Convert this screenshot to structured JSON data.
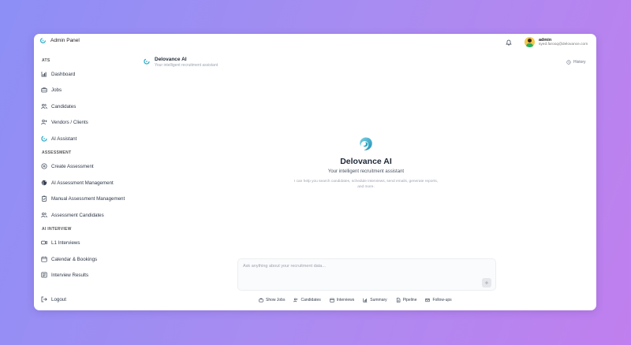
{
  "app": {
    "title": "Admin Panel"
  },
  "user": {
    "name": "admin",
    "email": "syed.farooq@delovance.com"
  },
  "sidebar": {
    "sections": [
      {
        "label": "ATS"
      },
      {
        "label": "ASSESSMENT"
      },
      {
        "label": "AI INTERVIEW"
      }
    ],
    "items": [
      {
        "label": "Dashboard",
        "icon": "chart-icon"
      },
      {
        "label": "Jobs",
        "icon": "briefcase-icon"
      },
      {
        "label": "Candidates",
        "icon": "users-icon"
      },
      {
        "label": "Vendors / Clients",
        "icon": "user-plus-icon"
      },
      {
        "label": "AI Assistant",
        "icon": "ai-logo-icon"
      },
      {
        "label": "Create Assessment",
        "icon": "plus-circle-icon"
      },
      {
        "label": "AI Assessment Management",
        "icon": "globe-icon"
      },
      {
        "label": "Manual Assessment Management",
        "icon": "clipboard-icon"
      },
      {
        "label": "Assessment Candidates",
        "icon": "users-icon"
      },
      {
        "label": "L1 Interviews",
        "icon": "video-icon"
      },
      {
        "label": "Calendar & Bookings",
        "icon": "calendar-icon"
      },
      {
        "label": "Interview Results",
        "icon": "results-icon"
      }
    ],
    "logout": "Logout"
  },
  "chat": {
    "title": "Delovance AI",
    "subtitle": "Your intelligent recruitment assistant",
    "history_label": "History"
  },
  "hero": {
    "title": "Delovance AI",
    "subtitle": "Your intelligent recruitment assistant",
    "description": "I can help you search candidates, schedule interviews, send emails, generate reports, and more."
  },
  "input": {
    "placeholder": "Ask anything about your recruitment data..."
  },
  "quick_actions": [
    {
      "label": "Show Jobs",
      "icon": "briefcase-icon"
    },
    {
      "label": "Candidates",
      "icon": "users-icon"
    },
    {
      "label": "Interviews",
      "icon": "calendar-icon"
    },
    {
      "label": "Summary",
      "icon": "bar-chart-icon"
    },
    {
      "label": "Pipeline",
      "icon": "document-icon"
    },
    {
      "label": "Follow-ups",
      "icon": "mail-icon"
    }
  ],
  "colors": {
    "accent": "#2aa8c4",
    "background_start": "#8d8ff6",
    "background_end": "#c07fee",
    "text_primary": "#1f2937",
    "text_muted": "#9ca3af"
  }
}
